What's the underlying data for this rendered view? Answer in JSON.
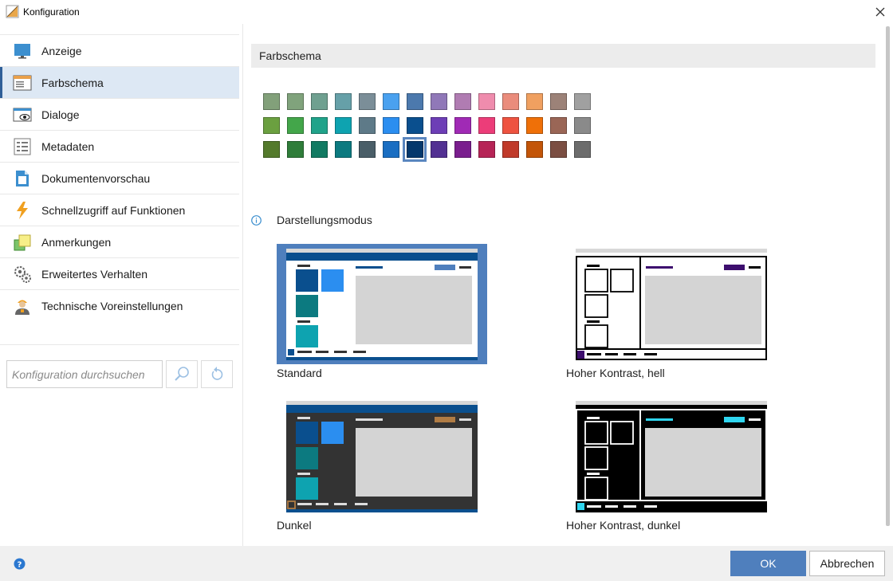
{
  "window": {
    "title": "Konfiguration"
  },
  "sidebar": {
    "items": [
      {
        "label": "Anzeige",
        "icon": "monitor-icon",
        "active": false
      },
      {
        "label": "Farbschema",
        "icon": "color-scheme-icon",
        "active": true
      },
      {
        "label": "Dialoge",
        "icon": "dialog-eye-icon",
        "active": false
      },
      {
        "label": "Metadaten",
        "icon": "metadata-list-icon",
        "active": false
      },
      {
        "label": "Dokumentenvorschau",
        "icon": "document-preview-icon",
        "active": false
      },
      {
        "label": "Schnellzugriff auf Funktionen",
        "icon": "lightning-icon",
        "active": false
      },
      {
        "label": "Anmerkungen",
        "icon": "sticky-notes-icon",
        "active": false
      },
      {
        "label": "Erweitertes Verhalten",
        "icon": "gears-icon",
        "active": false
      },
      {
        "label": "Technische Voreinstellungen",
        "icon": "technician-icon",
        "active": false
      }
    ],
    "search_placeholder": "Konfiguration durchsuchen"
  },
  "color_scheme": {
    "title": "Farbschema",
    "rows": [
      [
        "#82a07a",
        "#80a37c",
        "#6fa090",
        "#66a0a8",
        "#7b8e98",
        "#4aa1ef",
        "#4c79ad",
        "#9078b8",
        "#b07cb2",
        "#ef8cad",
        "#ea8c7c",
        "#f0a060",
        "#9c8278",
        "#a0a0a0"
      ],
      [
        "#6ba040",
        "#43a64a",
        "#20a38a",
        "#0ea3b0",
        "#5e7a88",
        "#2b8ef0",
        "#0a4f8e",
        "#6d3eb6",
        "#a02ab5",
        "#ec3d79",
        "#ee5340",
        "#ef7008",
        "#9a6656",
        "#8a8a8a"
      ],
      [
        "#547a2c",
        "#2f7d3a",
        "#117a62",
        "#0c7a80",
        "#4a5e68",
        "#1a6ec2",
        "#05386c",
        "#523092",
        "#7a1e8e",
        "#b62456",
        "#c03a2a",
        "#c35508",
        "#7b4e42",
        "#6c6c6c"
      ]
    ],
    "selected": {
      "row": 2,
      "col": 6
    }
  },
  "display_mode": {
    "title": "Darstellungsmodus",
    "options": [
      {
        "label": "Standard",
        "selected": true
      },
      {
        "label": "Hoher Kontrast, hell",
        "selected": false
      },
      {
        "label": "Dunkel",
        "selected": false
      },
      {
        "label": "Hoher Kontrast, dunkel",
        "selected": false
      }
    ]
  },
  "footer": {
    "ok_label": "OK",
    "cancel_label": "Abbrechen"
  },
  "colors": {
    "accent": "#4f7fbd",
    "selection": "#dde8f4",
    "selection_bar": "#2f5f98",
    "header_bg": "#ececec"
  }
}
